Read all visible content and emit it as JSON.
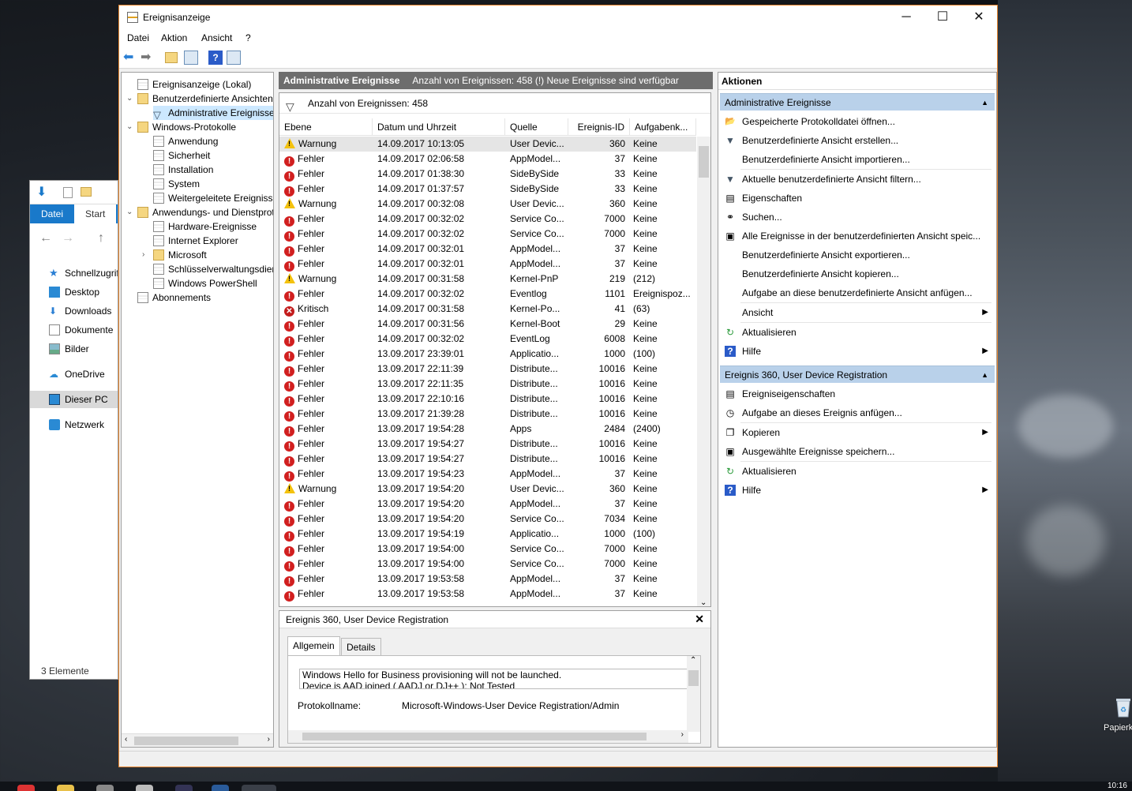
{
  "window": {
    "title": "Ereignisanzeige",
    "minimize": "─",
    "maximize": "☐",
    "close": "✕"
  },
  "menu": [
    "Datei",
    "Aktion",
    "Ansicht",
    "?"
  ],
  "tree": [
    {
      "label": "Ereignisanzeige (Lokal)",
      "level": 0,
      "toggle": "",
      "icon": "doc"
    },
    {
      "label": "Benutzerdefinierte Ansichten",
      "level": 1,
      "toggle": "⌄",
      "icon": "folder"
    },
    {
      "label": "Administrative Ereignisse",
      "level": 2,
      "toggle": "",
      "icon": "filter",
      "selected": true
    },
    {
      "label": "Windows-Protokolle",
      "level": 1,
      "toggle": "⌄",
      "icon": "folder"
    },
    {
      "label": "Anwendung",
      "level": 2,
      "toggle": "",
      "icon": "doc"
    },
    {
      "label": "Sicherheit",
      "level": 2,
      "toggle": "",
      "icon": "doc"
    },
    {
      "label": "Installation",
      "level": 2,
      "toggle": "",
      "icon": "doc"
    },
    {
      "label": "System",
      "level": 2,
      "toggle": "",
      "icon": "doc"
    },
    {
      "label": "Weitergeleitete Ereignisse",
      "level": 2,
      "toggle": "",
      "icon": "doc"
    },
    {
      "label": "Anwendungs- und Dienstprotokolle",
      "level": 1,
      "toggle": "⌄",
      "icon": "folder"
    },
    {
      "label": "Hardware-Ereignisse",
      "level": 2,
      "toggle": "",
      "icon": "doc"
    },
    {
      "label": "Internet Explorer",
      "level": 2,
      "toggle": "",
      "icon": "doc"
    },
    {
      "label": "Microsoft",
      "level": 2,
      "toggle": "›",
      "icon": "folder"
    },
    {
      "label": "Schlüsselverwaltungsdienst",
      "level": 2,
      "toggle": "",
      "icon": "doc"
    },
    {
      "label": "Windows PowerShell",
      "level": 2,
      "toggle": "",
      "icon": "doc"
    },
    {
      "label": "Abonnements",
      "level": 1,
      "toggle": "",
      "icon": "doc"
    }
  ],
  "center": {
    "title": "Administrative Ereignisse",
    "info": "Anzahl von Ereignissen: 458 (!) Neue Ereignisse sind verfügbar",
    "filter_text": "Anzahl von Ereignissen: 458"
  },
  "columns": [
    "Ebene",
    "Datum und Uhrzeit",
    "Quelle",
    "Ereignis-ID",
    "Aufgabenk..."
  ],
  "events": [
    {
      "level": "Warnung",
      "date": "14.09.2017 10:13:05",
      "source": "User Devic...",
      "id": "360",
      "task": "Keine"
    },
    {
      "level": "Fehler",
      "date": "14.09.2017 02:06:58",
      "source": "AppModel...",
      "id": "37",
      "task": "Keine"
    },
    {
      "level": "Fehler",
      "date": "14.09.2017 01:38:30",
      "source": "SideBySide",
      "id": "33",
      "task": "Keine"
    },
    {
      "level": "Fehler",
      "date": "14.09.2017 01:37:57",
      "source": "SideBySide",
      "id": "33",
      "task": "Keine"
    },
    {
      "level": "Warnung",
      "date": "14.09.2017 00:32:08",
      "source": "User Devic...",
      "id": "360",
      "task": "Keine"
    },
    {
      "level": "Fehler",
      "date": "14.09.2017 00:32:02",
      "source": "Service Co...",
      "id": "7000",
      "task": "Keine"
    },
    {
      "level": "Fehler",
      "date": "14.09.2017 00:32:02",
      "source": "Service Co...",
      "id": "7000",
      "task": "Keine"
    },
    {
      "level": "Fehler",
      "date": "14.09.2017 00:32:01",
      "source": "AppModel...",
      "id": "37",
      "task": "Keine"
    },
    {
      "level": "Fehler",
      "date": "14.09.2017 00:32:01",
      "source": "AppModel...",
      "id": "37",
      "task": "Keine"
    },
    {
      "level": "Warnung",
      "date": "14.09.2017 00:31:58",
      "source": "Kernel-PnP",
      "id": "219",
      "task": "(212)"
    },
    {
      "level": "Fehler",
      "date": "14.09.2017 00:32:02",
      "source": "Eventlog",
      "id": "1101",
      "task": "Ereignispoz..."
    },
    {
      "level": "Kritisch",
      "date": "14.09.2017 00:31:58",
      "source": "Kernel-Po...",
      "id": "41",
      "task": "(63)"
    },
    {
      "level": "Fehler",
      "date": "14.09.2017 00:31:56",
      "source": "Kernel-Boot",
      "id": "29",
      "task": "Keine"
    },
    {
      "level": "Fehler",
      "date": "14.09.2017 00:32:02",
      "source": "EventLog",
      "id": "6008",
      "task": "Keine"
    },
    {
      "level": "Fehler",
      "date": "13.09.2017 23:39:01",
      "source": "Applicatio...",
      "id": "1000",
      "task": "(100)"
    },
    {
      "level": "Fehler",
      "date": "13.09.2017 22:11:39",
      "source": "Distribute...",
      "id": "10016",
      "task": "Keine"
    },
    {
      "level": "Fehler",
      "date": "13.09.2017 22:11:35",
      "source": "Distribute...",
      "id": "10016",
      "task": "Keine"
    },
    {
      "level": "Fehler",
      "date": "13.09.2017 22:10:16",
      "source": "Distribute...",
      "id": "10016",
      "task": "Keine"
    },
    {
      "level": "Fehler",
      "date": "13.09.2017 21:39:28",
      "source": "Distribute...",
      "id": "10016",
      "task": "Keine"
    },
    {
      "level": "Fehler",
      "date": "13.09.2017 19:54:28",
      "source": "Apps",
      "id": "2484",
      "task": "(2400)"
    },
    {
      "level": "Fehler",
      "date": "13.09.2017 19:54:27",
      "source": "Distribute...",
      "id": "10016",
      "task": "Keine"
    },
    {
      "level": "Fehler",
      "date": "13.09.2017 19:54:27",
      "source": "Distribute...",
      "id": "10016",
      "task": "Keine"
    },
    {
      "level": "Fehler",
      "date": "13.09.2017 19:54:23",
      "source": "AppModel...",
      "id": "37",
      "task": "Keine"
    },
    {
      "level": "Warnung",
      "date": "13.09.2017 19:54:20",
      "source": "User Devic...",
      "id": "360",
      "task": "Keine"
    },
    {
      "level": "Fehler",
      "date": "13.09.2017 19:54:20",
      "source": "AppModel...",
      "id": "37",
      "task": "Keine"
    },
    {
      "level": "Fehler",
      "date": "13.09.2017 19:54:20",
      "source": "Service Co...",
      "id": "7034",
      "task": "Keine"
    },
    {
      "level": "Fehler",
      "date": "13.09.2017 19:54:19",
      "source": "Applicatio...",
      "id": "1000",
      "task": "(100)"
    },
    {
      "level": "Fehler",
      "date": "13.09.2017 19:54:00",
      "source": "Service Co...",
      "id": "7000",
      "task": "Keine"
    },
    {
      "level": "Fehler",
      "date": "13.09.2017 19:54:00",
      "source": "Service Co...",
      "id": "7000",
      "task": "Keine"
    },
    {
      "level": "Fehler",
      "date": "13.09.2017 19:53:58",
      "source": "AppModel...",
      "id": "37",
      "task": "Keine"
    },
    {
      "level": "Fehler",
      "date": "13.09.2017 19:53:58",
      "source": "AppModel...",
      "id": "37",
      "task": "Keine"
    }
  ],
  "detail": {
    "title": "Ereignis 360, User Device Registration",
    "close": "✕",
    "tabs": [
      "Allgemein",
      "Details"
    ],
    "message_line1": "Windows Hello for Business provisioning will not be launched.",
    "message_line2": "Device is AAD joined ( AADJ or DJ++ ): Not Tested",
    "log_label": "Protokollname:",
    "log_value": "Microsoft-Windows-User Device Registration/Admin"
  },
  "actions": {
    "header": "Aktionen",
    "group1": {
      "title": "Administrative Ereignisse",
      "items": [
        {
          "label": "Gespeicherte Protokolldatei öffnen...",
          "icon": "open-folder-icon",
          "glyph": "📂"
        },
        {
          "label": "Benutzerdefinierte Ansicht erstellen...",
          "icon": "filter-icon",
          "glyph": "▼"
        },
        {
          "label": "Benutzerdefinierte Ansicht importieren...",
          "icon": "",
          "glyph": ""
        },
        {
          "label": "Aktuelle benutzerdefinierte Ansicht filtern...",
          "icon": "filter-icon",
          "glyph": "▼"
        },
        {
          "label": "Eigenschaften",
          "icon": "properties-icon",
          "glyph": "▤"
        },
        {
          "label": "Suchen...",
          "icon": "binoculars-icon",
          "glyph": "⚭"
        },
        {
          "label": "Alle Ereignisse in der benutzerdefinierten Ansicht speic...",
          "icon": "save-icon",
          "glyph": "▣"
        },
        {
          "label": "Benutzerdefinierte Ansicht exportieren...",
          "icon": "",
          "glyph": ""
        },
        {
          "label": "Benutzerdefinierte Ansicht kopieren...",
          "icon": "",
          "glyph": ""
        },
        {
          "label": "Aufgabe an diese benutzerdefinierte Ansicht anfügen...",
          "icon": "",
          "glyph": ""
        },
        {
          "label": "Ansicht",
          "icon": "",
          "glyph": "",
          "submenu": true
        },
        {
          "label": "Aktualisieren",
          "icon": "refresh-icon",
          "glyph": "↻"
        },
        {
          "label": "Hilfe",
          "icon": "help-icon",
          "glyph": "?",
          "submenu": true
        }
      ]
    },
    "group2": {
      "title": "Ereignis 360, User Device Registration",
      "items": [
        {
          "label": "Ereigniseigenschaften",
          "icon": "properties-icon",
          "glyph": "▤"
        },
        {
          "label": "Aufgabe an dieses Ereignis anfügen...",
          "icon": "task-icon",
          "glyph": "◷"
        },
        {
          "label": "Kopieren",
          "icon": "copy-icon",
          "glyph": "❐",
          "submenu": true
        },
        {
          "label": "Ausgewählte Ereignisse speichern...",
          "icon": "save-icon",
          "glyph": "▣"
        },
        {
          "label": "Aktualisieren",
          "icon": "refresh-icon",
          "glyph": "↻"
        },
        {
          "label": "Hilfe",
          "icon": "help-icon",
          "glyph": "?",
          "submenu": true
        }
      ]
    }
  },
  "explorer": {
    "tabs": [
      "Datei",
      "Start"
    ],
    "nav": [
      "Schnellzugriff",
      "Desktop",
      "Downloads",
      "Dokumente",
      "Bilder",
      "OneDrive",
      "Dieser PC",
      "Netzwerk"
    ],
    "status": "3 Elemente"
  },
  "desktop": {
    "recycle_label": "Papierkorb",
    "clock": "10:16"
  },
  "colors": {
    "accent_border": "#e8862f",
    "group_header": "#b9d1ea",
    "center_header": "#6d6d6d",
    "error": "#d11f1f",
    "warning": "#f4c20d"
  }
}
